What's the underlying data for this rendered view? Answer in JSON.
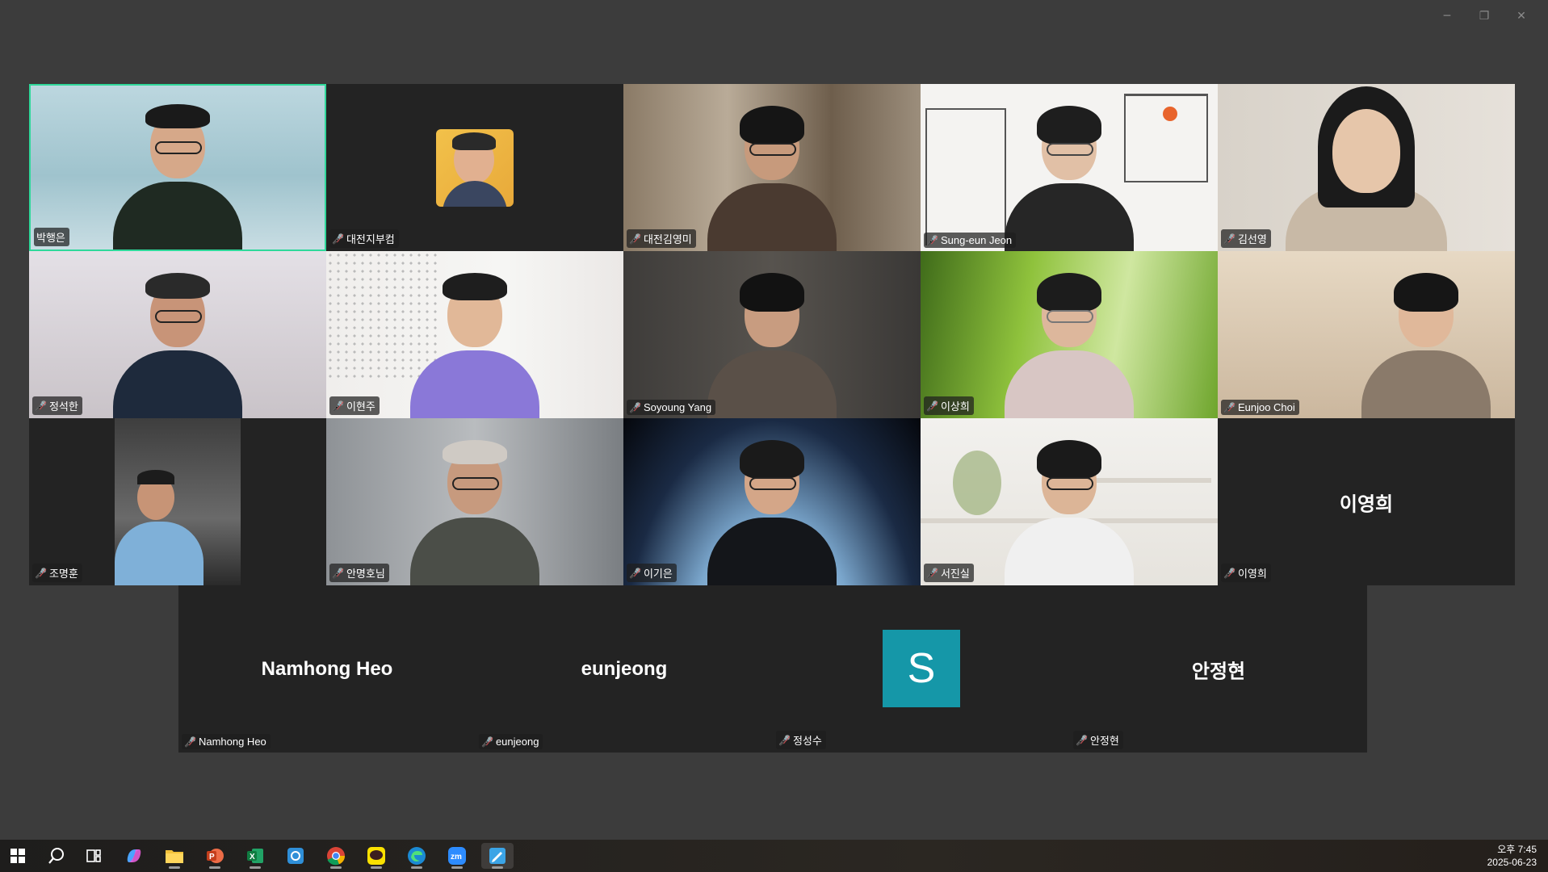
{
  "window_controls": {
    "minimize": "─",
    "restore": "❐",
    "close": "✕"
  },
  "participants": [
    {
      "name": "박행은",
      "muted": false,
      "active": true
    },
    {
      "name": "대전지부컴",
      "muted": true
    },
    {
      "name": "대전김영미",
      "muted": true
    },
    {
      "name": "Sung-eun Jeon",
      "muted": true
    },
    {
      "name": "김선영",
      "muted": true
    },
    {
      "name": "정석한",
      "muted": true
    },
    {
      "name": "이현주",
      "muted": true
    },
    {
      "name": "Soyoung Yang",
      "muted": true
    },
    {
      "name": "이상희",
      "muted": true
    },
    {
      "name": "Eunjoo Choi",
      "muted": true
    },
    {
      "name": "조명훈",
      "muted": true
    },
    {
      "name": "안명호님",
      "muted": true
    },
    {
      "name": "이기은",
      "muted": true
    },
    {
      "name": "서진실",
      "muted": true
    },
    {
      "name": "이영희",
      "muted": true,
      "display_name": "이영희"
    }
  ],
  "bottom_participants": [
    {
      "name": "Namhong Heo",
      "display_name": "Namhong Heo",
      "muted": true
    },
    {
      "name": "eunjeong",
      "display_name": "eunjeong",
      "muted": true
    },
    {
      "name": "정성수",
      "avatar_letter": "S",
      "muted": true
    },
    {
      "name": "안정현",
      "display_name": "안정현",
      "muted": true
    }
  ],
  "mic_muted_icon": "🎤̸",
  "taskbar": {
    "icons": [
      "windows-start-icon",
      "search-icon",
      "task-view-icon",
      "copilot-icon",
      "file-explorer-icon",
      "powerpoint-icon",
      "excel-icon",
      "hancom-icon",
      "chrome-icon",
      "kakaotalk-icon",
      "edge-icon",
      "zoom-icon",
      "whiteboard-icon"
    ],
    "clock_time": "오후 7:45",
    "clock_date": "2025-06-23"
  },
  "colors": {
    "active_border": "#2fd89a",
    "avatar_bg": "#1597a8",
    "muted_mic": "#e5484d"
  }
}
